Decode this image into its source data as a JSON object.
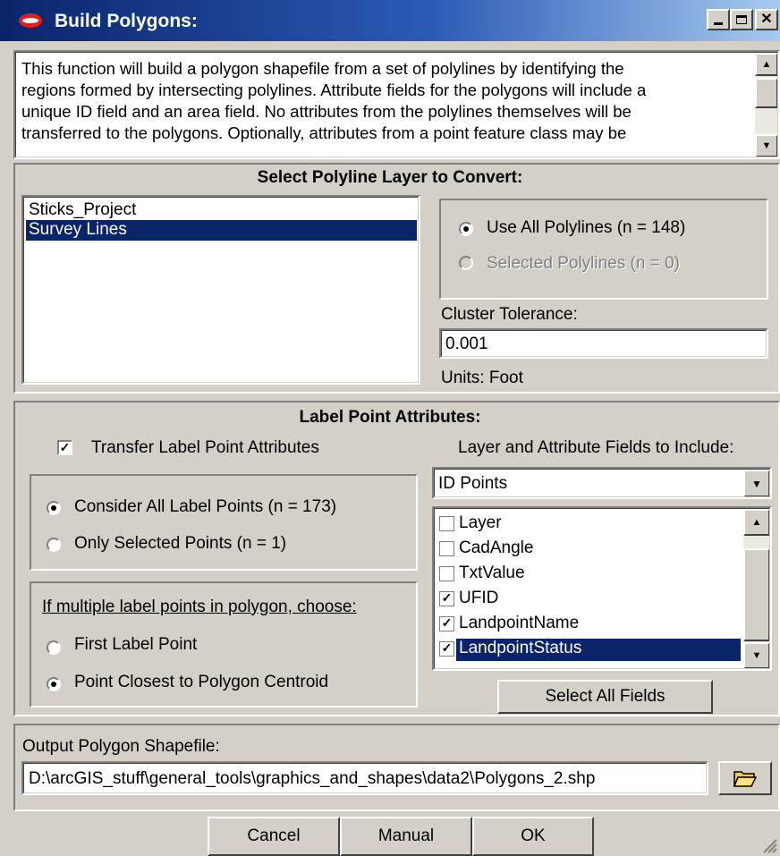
{
  "window": {
    "title": "Build Polygons:"
  },
  "description": {
    "lines": [
      "This function will build a polygon shapefile from a set of polylines by identifying the",
      "regions formed by intersecting polylines.  Attribute fields for the polygons will include a",
      "unique ID field and an area field.  No attributes from the polylines themselves will be",
      "transferred to the polygons.  Optionally, attributes from a point feature class may be"
    ]
  },
  "polyline_section": {
    "heading": "Select Polyline Layer to Convert:",
    "layers": [
      "Sticks_Project",
      "Survey Lines"
    ],
    "selected_layer": "Survey Lines",
    "use_all_label": "Use All Polylines (n = 148)",
    "selected_label": "Selected Polylines (n = 0)",
    "tolerance_label": "Cluster Tolerance:",
    "tolerance_value": "0.001",
    "units_label": "Units: Foot"
  },
  "label_section": {
    "heading": "Label Point Attributes:",
    "transfer_label": "Transfer Label Point Attributes",
    "transfer_checked": true,
    "consider_all_label": "Consider All Label Points (n = 173)",
    "only_selected_label": "Only Selected Points (n = 1)",
    "multiple_heading": "If multiple label points in polygon, choose:",
    "first_point_label": "First Label Point",
    "closest_point_label": "Point Closest to Polygon Centroid",
    "fields_heading": "Layer and Attribute Fields to Include:",
    "layer_select_value": "ID Points",
    "fields": [
      {
        "name": "Layer",
        "checked": false
      },
      {
        "name": "CadAngle",
        "checked": false
      },
      {
        "name": "TxtValue",
        "checked": false
      },
      {
        "name": "UFID",
        "checked": true
      },
      {
        "name": "LandpointName",
        "checked": true
      },
      {
        "name": "LandpointStatus",
        "checked": true
      }
    ],
    "select_all_label": "Select All Fields"
  },
  "output": {
    "label": "Output Polygon Shapefile:",
    "path": "D:\\arcGIS_stuff\\general_tools\\graphics_and_shapes\\data2\\Polygons_2.shp"
  },
  "buttons": {
    "cancel": "Cancel",
    "manual": "Manual",
    "ok": "OK"
  },
  "colors": {
    "selection": "#0a246a",
    "face": "#d4d0c8"
  },
  "icons": {
    "app": "red-diamond-icon",
    "folder": "open-folder-icon"
  }
}
